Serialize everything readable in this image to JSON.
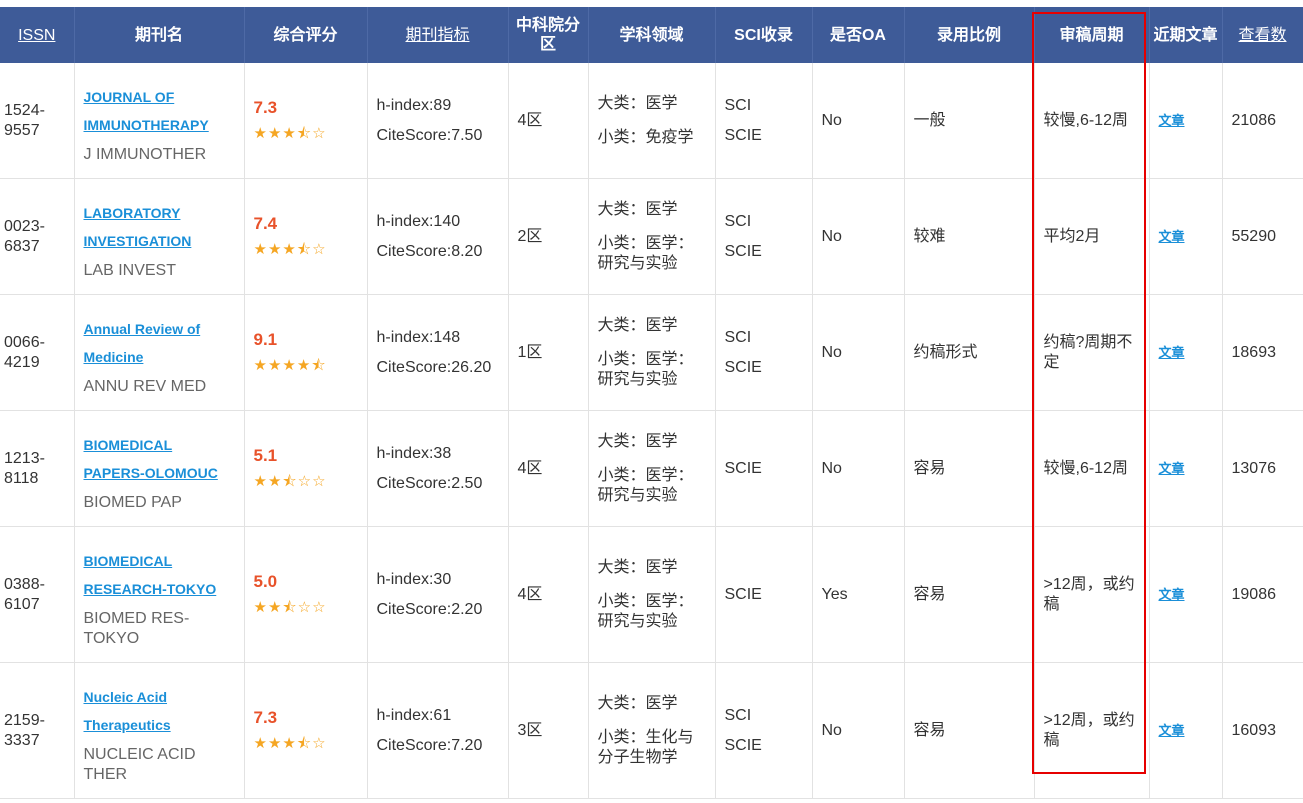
{
  "headers": {
    "issn": "ISSN",
    "name": "期刊名",
    "score": "综合评分",
    "metrics": "期刊指标",
    "zone": "中科院分区",
    "field": "学科领域",
    "sci": "SCI收录",
    "oa": "是否OA",
    "acceptance": "录用比例",
    "review": "审稿周期",
    "recent": "近期文章",
    "views": "查看数"
  },
  "rows": [
    {
      "issn": [
        "1524-",
        "9557"
      ],
      "name": [
        "JOURNAL OF",
        "IMMUNOTHERAPY"
      ],
      "abbr": "J IMMUNOTHER",
      "score": "7.3",
      "stars": 3.5,
      "hindex": "h-index:89",
      "citescore": "CiteScore:7.50",
      "zone": "4区",
      "major": "大类：医学",
      "minor": "小类：免疫学",
      "sci": [
        "SCI",
        "SCIE"
      ],
      "oa": "No",
      "acceptance": "一般",
      "review": "较慢,6-12周",
      "article": "文章",
      "views": "21086"
    },
    {
      "issn": [
        "0023-",
        "6837"
      ],
      "name": [
        "LABORATORY",
        "INVESTIGATION"
      ],
      "abbr": "LAB INVEST",
      "score": "7.4",
      "stars": 3.5,
      "hindex": "h-index:140",
      "citescore": "CiteScore:8.20",
      "zone": "2区",
      "major": "大类：医学",
      "minor": "小类：医学：研究与实验",
      "sci": [
        "SCI",
        "SCIE"
      ],
      "oa": "No",
      "acceptance": "较难",
      "review": "平均2月",
      "article": "文章",
      "views": "55290"
    },
    {
      "issn": [
        "0066-",
        "4219"
      ],
      "name": [
        "Annual Review of",
        "Medicine"
      ],
      "abbr": "ANNU REV MED",
      "score": "9.1",
      "stars": 4.5,
      "hindex": "h-index:148",
      "citescore": "CiteScore:26.20",
      "zone": "1区",
      "major": "大类：医学",
      "minor": "小类：医学：研究与实验",
      "sci": [
        "SCI",
        "SCIE"
      ],
      "oa": "No",
      "acceptance": "约稿形式",
      "review": "约稿?周期不定",
      "article": "文章",
      "views": "18693"
    },
    {
      "issn": [
        "1213-",
        "8118"
      ],
      "name": [
        "BIOMEDICAL",
        "PAPERS-OLOMOUC"
      ],
      "abbr": "BIOMED PAP",
      "score": "5.1",
      "stars": 2.5,
      "hindex": "h-index:38",
      "citescore": "CiteScore:2.50",
      "zone": "4区",
      "major": "大类：医学",
      "minor": "小类：医学：研究与实验",
      "sci": [
        "SCIE"
      ],
      "oa": "No",
      "acceptance": "容易",
      "review": "较慢,6-12周",
      "article": "文章",
      "views": "13076"
    },
    {
      "issn": [
        "0388-",
        "6107"
      ],
      "name": [
        "BIOMEDICAL",
        "RESEARCH-TOKYO"
      ],
      "abbr": "BIOMED RES-TOKYO",
      "score": "5.0",
      "stars": 2.5,
      "hindex": "h-index:30",
      "citescore": "CiteScore:2.20",
      "zone": "4区",
      "major": "大类：医学",
      "minor": "小类：医学：研究与实验",
      "sci": [
        "SCIE"
      ],
      "oa": "Yes",
      "acceptance": "容易",
      "review": ">12周，或约稿",
      "article": "文章",
      "views": "19086"
    },
    {
      "issn": [
        "2159-",
        "3337"
      ],
      "name": [
        "Nucleic Acid",
        "Therapeutics"
      ],
      "abbr": "NUCLEIC ACID THER",
      "score": "7.3",
      "stars": 3.5,
      "hindex": "h-index:61",
      "citescore": "CiteScore:7.20",
      "zone": "3区",
      "major": "大类：医学",
      "minor": "小类：生化与分子生物学",
      "sci": [
        "SCI",
        "SCIE"
      ],
      "oa": "No",
      "acceptance": "容易",
      "review": ">12周，或约稿",
      "article": "文章",
      "views": "16093"
    }
  ],
  "colors": {
    "header_bg": "#3e5b98",
    "link": "#1a8fd8",
    "score": "#e8522a",
    "star": "#f5a623",
    "highlight": "#e60000"
  }
}
